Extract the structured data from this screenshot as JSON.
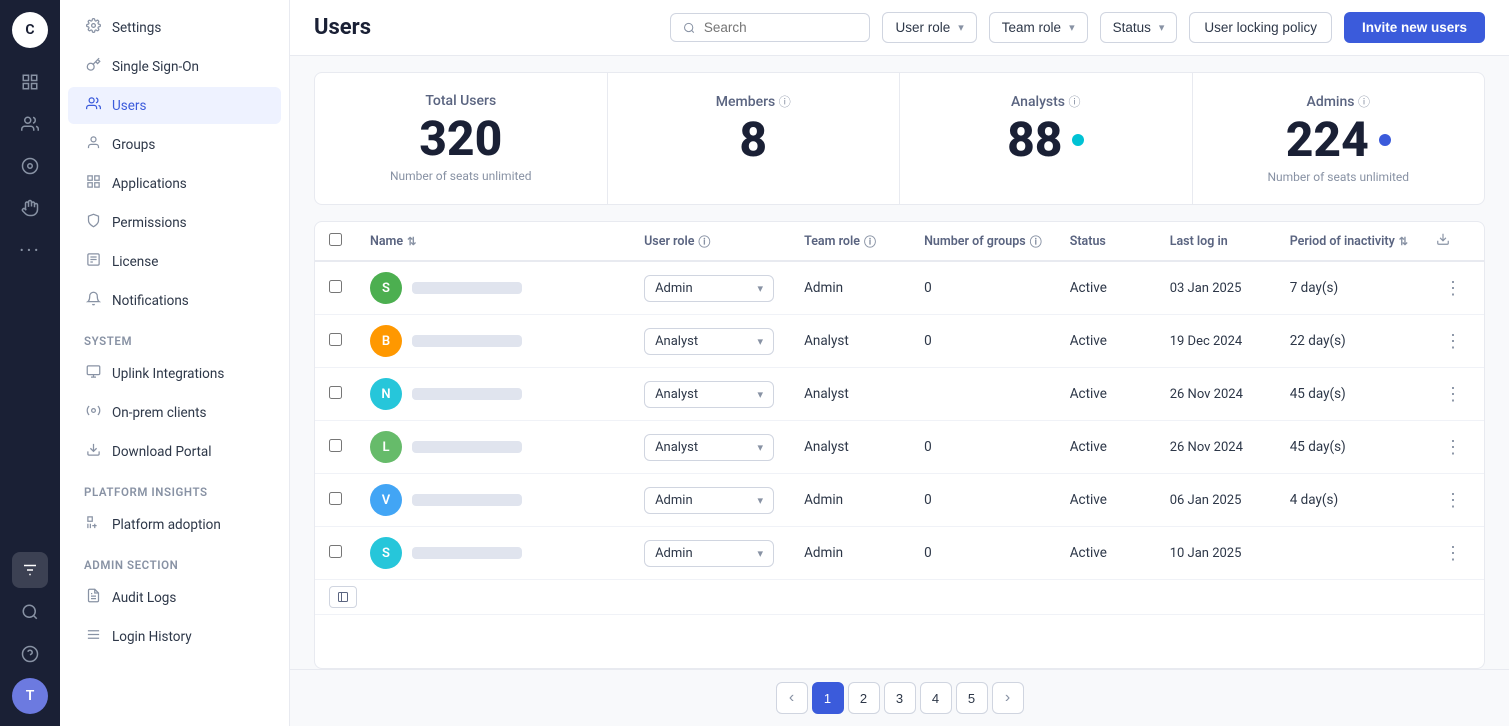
{
  "app": {
    "logo": "C"
  },
  "icon_nav": [
    {
      "name": "home-icon",
      "symbol": "⊞"
    },
    {
      "name": "grid-icon",
      "symbol": "⋮⋮"
    },
    {
      "name": "target-icon",
      "symbol": "◎"
    },
    {
      "name": "hand-icon",
      "symbol": "✋"
    },
    {
      "name": "more-icon",
      "symbol": "···"
    }
  ],
  "icon_nav_bottom": [
    {
      "name": "filter-icon",
      "symbol": "⧉"
    },
    {
      "name": "search-icon-left",
      "symbol": "🔍"
    },
    {
      "name": "help-icon",
      "symbol": "?"
    }
  ],
  "user_initial_bottom": "T",
  "sidebar": {
    "items": [
      {
        "name": "sidebar-item-settings",
        "label": "Settings",
        "icon": "⚙"
      },
      {
        "name": "sidebar-item-sso",
        "label": "Single Sign-On",
        "icon": "🔑"
      },
      {
        "name": "sidebar-item-users",
        "label": "Users",
        "icon": "👥",
        "active": true
      },
      {
        "name": "sidebar-item-groups",
        "label": "Groups",
        "icon": "👤"
      },
      {
        "name": "sidebar-item-applications",
        "label": "Applications",
        "icon": "⊞"
      },
      {
        "name": "sidebar-item-permissions",
        "label": "Permissions",
        "icon": "🛡"
      },
      {
        "name": "sidebar-item-license",
        "label": "License",
        "icon": "📄"
      },
      {
        "name": "sidebar-item-notifications",
        "label": "Notifications",
        "icon": "🔔"
      }
    ],
    "sections": {
      "system": {
        "label": "System",
        "items": [
          {
            "name": "sidebar-item-uplink",
            "label": "Uplink Integrations",
            "icon": "⊡"
          },
          {
            "name": "sidebar-item-onprem",
            "label": "On-prem clients",
            "icon": "⊙"
          },
          {
            "name": "sidebar-item-download",
            "label": "Download Portal",
            "icon": "⬇"
          }
        ]
      },
      "platform_insights": {
        "label": "Platform Insights",
        "items": [
          {
            "name": "sidebar-item-adoption",
            "label": "Platform adoption",
            "icon": "📊"
          }
        ]
      },
      "admin_section": {
        "label": "Admin Section",
        "items": [
          {
            "name": "sidebar-item-audit",
            "label": "Audit Logs",
            "icon": "📋"
          },
          {
            "name": "sidebar-item-login",
            "label": "Login History",
            "icon": "≡"
          }
        ]
      }
    }
  },
  "header": {
    "title": "Users",
    "search_placeholder": "Search",
    "dropdowns": [
      {
        "name": "user-role-dropdown",
        "label": "User role"
      },
      {
        "name": "team-role-dropdown",
        "label": "Team role"
      },
      {
        "name": "status-dropdown",
        "label": "Status"
      }
    ],
    "user_locking_label": "User locking policy",
    "invite_label": "Invite new users"
  },
  "stats": [
    {
      "name": "total-users-card",
      "label": "Total Users",
      "value": "320",
      "sublabel": "Number of seats unlimited",
      "dot": null
    },
    {
      "name": "members-card",
      "label": "Members",
      "value": "8",
      "sublabel": null,
      "dot": null,
      "info": true
    },
    {
      "name": "analysts-card",
      "label": "Analysts",
      "value": "88",
      "sublabel": null,
      "dot": "cyan",
      "info": true
    },
    {
      "name": "admins-card",
      "label": "Admins",
      "value": "224",
      "sublabel": "Number of seats unlimited",
      "dot": "blue",
      "info": true
    }
  ],
  "table": {
    "columns": [
      {
        "key": "checkbox",
        "label": ""
      },
      {
        "key": "name",
        "label": "Name",
        "sortable": true
      },
      {
        "key": "user_role",
        "label": "User role",
        "info": true
      },
      {
        "key": "team_role",
        "label": "Team role",
        "info": true
      },
      {
        "key": "number_of_groups",
        "label": "Number of groups",
        "info": true
      },
      {
        "key": "status",
        "label": "Status"
      },
      {
        "key": "last_log_in",
        "label": "Last log in"
      },
      {
        "key": "period_of_inactivity",
        "label": "Period of inactivity",
        "sortable": true
      },
      {
        "key": "download",
        "label": ""
      }
    ],
    "rows": [
      {
        "id": 1,
        "initial": "S",
        "avatar_color": "#4CAF50",
        "user_role": "Admin",
        "team_role": "Admin",
        "number_of_groups": "0",
        "status": "Active",
        "last_log_in": "03 Jan 2025",
        "period_of_inactivity": "7 day(s)"
      },
      {
        "id": 2,
        "initial": "B",
        "avatar_color": "#FF9800",
        "user_role": "Analyst",
        "team_role": "Analyst",
        "number_of_groups": "0",
        "status": "Active",
        "last_log_in": "19 Dec 2024",
        "period_of_inactivity": "22 day(s)"
      },
      {
        "id": 3,
        "initial": "N",
        "avatar_color": "#26C6DA",
        "user_role": "Analyst",
        "team_role": "Analyst",
        "number_of_groups": "",
        "status": "Active",
        "last_log_in": "26 Nov 2024",
        "period_of_inactivity": "45 day(s)"
      },
      {
        "id": 4,
        "initial": "L",
        "avatar_color": "#66BB6A",
        "user_role": "Analyst",
        "team_role": "Analyst",
        "number_of_groups": "0",
        "status": "Active",
        "last_log_in": "26 Nov 2024",
        "period_of_inactivity": "45 day(s)"
      },
      {
        "id": 5,
        "initial": "V",
        "avatar_color": "#42A5F5",
        "user_role": "Admin",
        "team_role": "Admin",
        "number_of_groups": "0",
        "status": "Active",
        "last_log_in": "06 Jan 2025",
        "period_of_inactivity": "4 day(s)"
      },
      {
        "id": 6,
        "initial": "S",
        "avatar_color": "#26C6DA",
        "user_role": "Admin",
        "team_role": "Admin",
        "number_of_groups": "0",
        "status": "Active",
        "last_log_in": "10 Jan 2025",
        "period_of_inactivity": ""
      }
    ]
  },
  "pagination": {
    "prev_label": "‹",
    "next_label": "›",
    "current_page": 1,
    "pages": [
      1,
      2,
      3,
      4,
      5
    ]
  }
}
